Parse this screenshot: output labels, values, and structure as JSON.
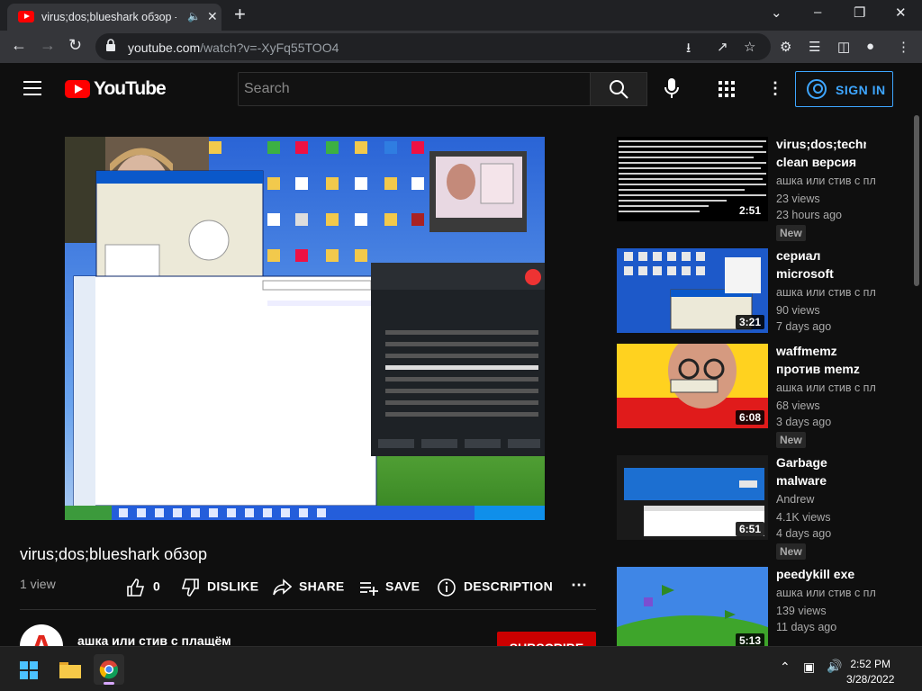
{
  "browser": {
    "tab_title": "virus;dos;blueshark обзор - YouTube",
    "url_main": "youtube.com",
    "url_rest": "/watch?v=-XyFq55TOO4"
  },
  "masthead": {
    "logo_text": "YouTube",
    "search_placeholder": "Search",
    "signin_label": "SIGN IN"
  },
  "video": {
    "title": "virus;dos;blueshark обзор",
    "views": "1 view",
    "likes": "0",
    "dislike_label": "DISLIKE",
    "share_label": "SHARE",
    "save_label": "SAVE",
    "description_label": "DESCRIPTION",
    "channel_name": "ашка или стив с плащём",
    "subscribe_label": "SUBSCRIBE"
  },
  "recommendations": [
    {
      "title": "virus;dos;techno clean версия",
      "channel": "ашка или стив с плащём",
      "views": "23 views",
      "age": "23 hours ago",
      "duration": "2:51",
      "badge": "New"
    },
    {
      "title": "сериал microsoft agent",
      "channel": "ашка или стив с плащём",
      "views": "90 views",
      "age": "7 days ago",
      "duration": "3:21",
      "badge": ""
    },
    {
      "title": "waffmemz против memz",
      "channel": "ашка или стив с плащём",
      "views": "68 views",
      "age": "3 days ago",
      "duration": "6:08",
      "badge": "New"
    },
    {
      "title": "Garbage malware",
      "channel": "Andrew",
      "views": "4.1K views",
      "age": "4 days ago",
      "duration": "6:51",
      "badge": "New"
    },
    {
      "title": "peedykill exe",
      "channel": "ашка или стив с плащём",
      "views": "139 views",
      "age": "11 days ago",
      "duration": "5:13",
      "badge": ""
    }
  ],
  "taskbar": {
    "time": "2:52 PM",
    "date": "3/28/2022"
  },
  "colors": {
    "yt_red": "#ff0000",
    "link_blue": "#3ea6ff",
    "bg": "#0f0f0f"
  }
}
